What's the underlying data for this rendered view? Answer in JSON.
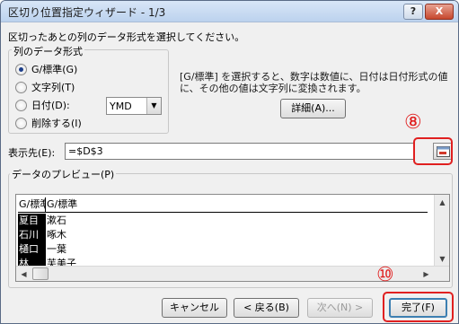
{
  "window": {
    "title": "区切り位置指定ウィザード - 1/3",
    "help_label": "?",
    "close_label": "X"
  },
  "subtitle": "区切ったあとの列のデータ形式を選択してください。",
  "column_format": {
    "legend": "列のデータ形式",
    "options": [
      {
        "label": "G/標準(G)",
        "checked": true
      },
      {
        "label": "文字列(T)",
        "checked": false
      },
      {
        "label": "日付(D):",
        "checked": false
      },
      {
        "label": "削除する(I)",
        "checked": false
      }
    ],
    "date_format": "YMD"
  },
  "description": "[G/標準] を選択すると、数字は数値に、日付は日付形式の値に、その他の値は文字列に変換されます。",
  "detail_button": "詳細(A)...",
  "destination": {
    "label": "表示先(E):",
    "value": "=$D$3"
  },
  "preview": {
    "legend": "データのプレビュー(P)",
    "headers": [
      "G/標準",
      "G/標準"
    ],
    "rows": [
      [
        "夏目",
        "漱石"
      ],
      [
        "石川",
        "啄木"
      ],
      [
        "樋口",
        "一葉"
      ],
      [
        "林",
        "芙美子"
      ]
    ]
  },
  "buttons": {
    "cancel": "キャンセル",
    "back": "< 戻る(B)",
    "next": "次へ(N) >",
    "finish": "完了(F)"
  },
  "annotations": {
    "step_8": "⑧",
    "step_10": "⑩"
  },
  "colors": {
    "annotation": "#e02020",
    "selection": "#000000"
  }
}
